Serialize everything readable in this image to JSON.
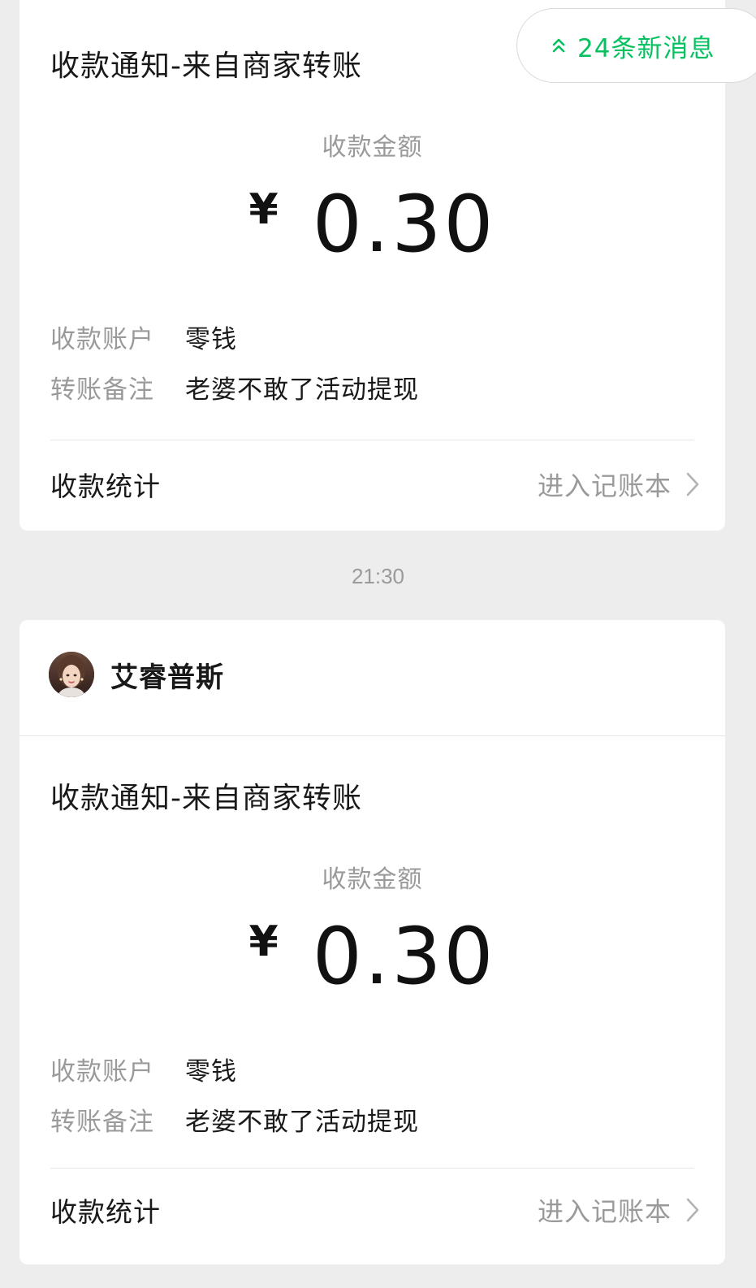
{
  "new_messages": {
    "label": "24条新消息",
    "icon": "double-chevron-up-icon",
    "color": "#07c160"
  },
  "timestamp": "21:30",
  "cards": [
    {
      "title": "收款通知-来自商家转账",
      "amount_caption": "收款金额",
      "currency": "¥",
      "amount": "0.30",
      "account_label": "收款账户",
      "account_value": "零钱",
      "note_label": "转账备注",
      "note_value": "老婆不敢了活动提现",
      "stats_label": "收款统计",
      "ledger_link": "进入记账本",
      "ledger_icon": "chevron-right-icon"
    },
    {
      "sender": {
        "name": "艾睿普斯",
        "avatar": "avatar"
      },
      "title": "收款通知-来自商家转账",
      "amount_caption": "收款金额",
      "currency": "¥",
      "amount": "0.30",
      "account_label": "收款账户",
      "account_value": "零钱",
      "note_label": "转账备注",
      "note_value": "老婆不敢了活动提现",
      "stats_label": "收款统计",
      "ledger_link": "进入记账本",
      "ledger_icon": "chevron-right-icon"
    }
  ]
}
